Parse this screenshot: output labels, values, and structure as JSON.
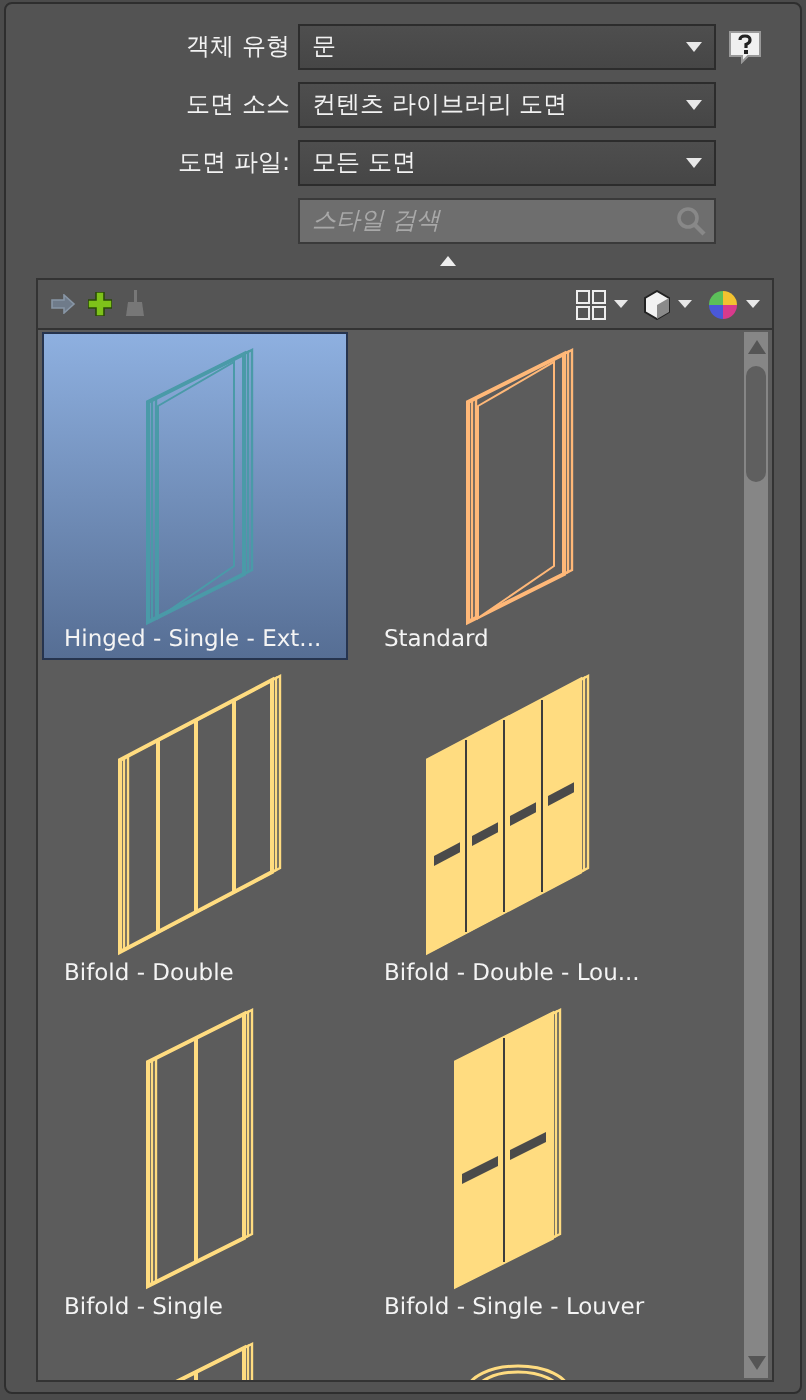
{
  "fields": [
    {
      "label": "객체 유형",
      "value": "문",
      "help": true
    },
    {
      "label": "도면 소스",
      "value": "컨텐츠 라이브러리 도면",
      "help": false
    },
    {
      "label": "도면 파일:",
      "value": "모든 도면",
      "help": false
    }
  ],
  "search": {
    "placeholder": "스타일 검색"
  },
  "styles": [
    {
      "label": "Hinged - Single - Ext...",
      "kind": "door-frame",
      "color": "#4a9aa8",
      "selected": true
    },
    {
      "label": "Standard",
      "kind": "door-frame",
      "color": "#ffb878",
      "selected": false
    },
    {
      "label": "Bifold - Double",
      "kind": "bifold-double",
      "color": "#ffdc80",
      "selected": false
    },
    {
      "label": "Bifold - Double - Lou...",
      "kind": "bifold-double-louver",
      "color": "#ffdc80",
      "selected": false
    },
    {
      "label": "Bifold - Single",
      "kind": "bifold-single",
      "color": "#ffdc80",
      "selected": false
    },
    {
      "label": "Bifold - Single - Louver",
      "kind": "bifold-single-louver",
      "color": "#ffdc80",
      "selected": false
    },
    {
      "kind": "bifold-single",
      "color": "#ffdc80",
      "selected": false
    },
    {
      "kind": "arched",
      "color": "#ffdc80",
      "selected": false
    }
  ]
}
